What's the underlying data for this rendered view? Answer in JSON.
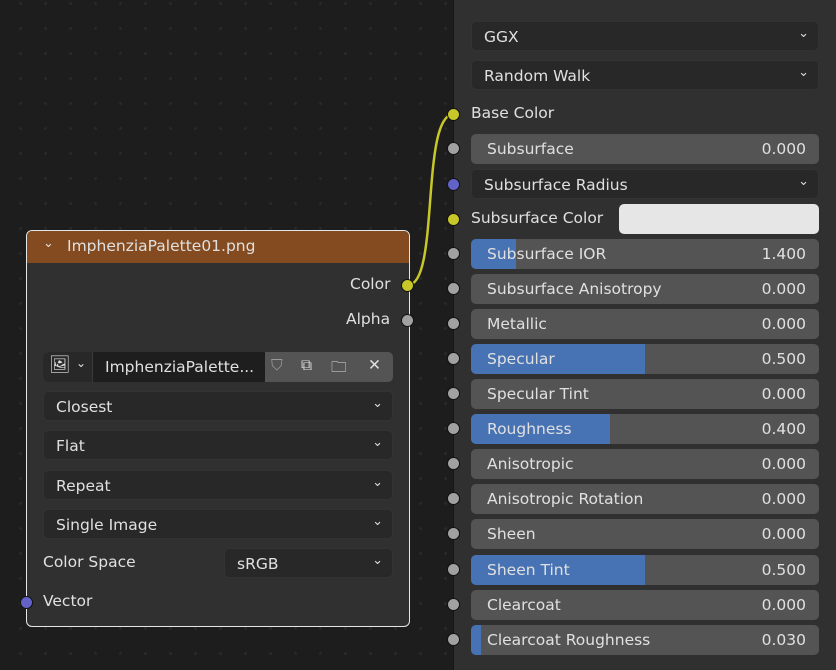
{
  "principled": {
    "distribution": "GGX",
    "subsurface_method": "Random Walk",
    "base_color_label": "Base Color",
    "subsurface_radius": "Subsurface Radius",
    "subsurface_color_label": "Subsurface Color",
    "subsurface_color": "#e6e6e6",
    "fields": [
      {
        "label": "Subsurface",
        "value": "0.000",
        "fill": 0
      },
      {
        "label": "Subsurface IOR",
        "value": "1.400",
        "fill": 0.13
      },
      {
        "label": "Subsurface Anisotropy",
        "value": "0.000",
        "fill": 0
      },
      {
        "label": "Metallic",
        "value": "0.000",
        "fill": 0
      },
      {
        "label": "Specular",
        "value": "0.500",
        "fill": 0.5
      },
      {
        "label": "Specular Tint",
        "value": "0.000",
        "fill": 0
      },
      {
        "label": "Roughness",
        "value": "0.400",
        "fill": 0.4
      },
      {
        "label": "Anisotropic",
        "value": "0.000",
        "fill": 0
      },
      {
        "label": "Anisotropic Rotation",
        "value": "0.000",
        "fill": 0
      },
      {
        "label": "Sheen",
        "value": "0.000",
        "fill": 0
      },
      {
        "label": "Sheen Tint",
        "value": "0.500",
        "fill": 0.5
      },
      {
        "label": "Clearcoat",
        "value": "0.000",
        "fill": 0
      },
      {
        "label": "Clearcoat Roughness",
        "value": "0.030",
        "fill": 0.03
      }
    ]
  },
  "image_node": {
    "title": "ImphenziaPalette01.png",
    "out_color": "Color",
    "out_alpha": "Alpha",
    "image_name": "ImphenziaPalette...",
    "interpolation": "Closest",
    "projection": "Flat",
    "extension": "Repeat",
    "source": "Single Image",
    "color_space_label": "Color Space",
    "color_space": "sRGB",
    "in_vector": "Vector"
  },
  "colors": {
    "yellow": "#c7c729",
    "gray": "#a1a1a1",
    "purple": "#6363c7",
    "header": "#834b1f",
    "slider": "#4772b3"
  }
}
